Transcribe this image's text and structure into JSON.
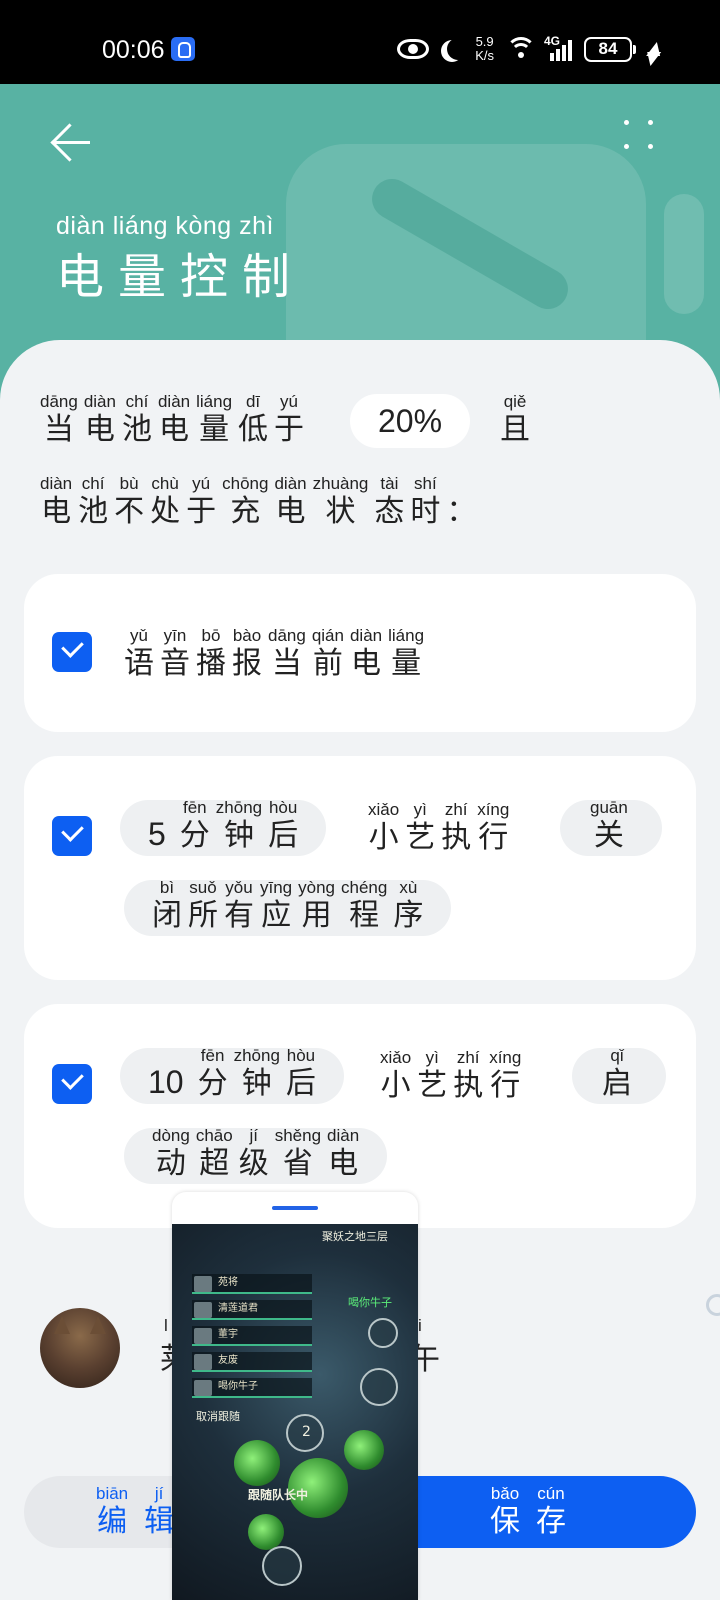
{
  "status_bar": {
    "time": "00:06",
    "net_speed_value": "5.9",
    "net_speed_unit": "K/s",
    "network_type": "4G",
    "battery_level": "84"
  },
  "header": {
    "title_pinyin": "diàn liáng kòng  zhì",
    "title": "电量控制"
  },
  "condition": {
    "line1": [
      {
        "py": "dāng",
        "hz": "当"
      },
      {
        "py": "diàn",
        "hz": "电"
      },
      {
        "py": "chí",
        "hz": "池"
      },
      {
        "py": "diàn",
        "hz": "电"
      },
      {
        "py": "liáng",
        "hz": "量"
      },
      {
        "py": "dī",
        "hz": "低"
      },
      {
        "py": "yú",
        "hz": "于"
      }
    ],
    "threshold": "20%",
    "and_py": "qiě",
    "and_hz": "且",
    "line2": [
      {
        "py": "diàn",
        "hz": "电"
      },
      {
        "py": "chí",
        "hz": "池"
      },
      {
        "py": "bù",
        "hz": "不"
      },
      {
        "py": "chù",
        "hz": "处"
      },
      {
        "py": "yú",
        "hz": "于"
      },
      {
        "py": "chōng",
        "hz": "充"
      },
      {
        "py": "diàn",
        "hz": "电"
      },
      {
        "py": "zhuàng",
        "hz": "状"
      },
      {
        "py": "tài",
        "hz": "态"
      },
      {
        "py": "shí",
        "hz": "时"
      },
      {
        "py": "",
        "hz": "："
      }
    ]
  },
  "actions": [
    {
      "checked": true,
      "text": [
        {
          "py": "yǔ",
          "hz": "语"
        },
        {
          "py": "yīn",
          "hz": "音"
        },
        {
          "py": "bō",
          "hz": "播"
        },
        {
          "py": "bào",
          "hz": "报"
        },
        {
          "py": "dāng",
          "hz": "当"
        },
        {
          "py": "qián",
          "hz": "前"
        },
        {
          "py": "diàn",
          "hz": "电"
        },
        {
          "py": "liáng",
          "hz": "量"
        }
      ]
    },
    {
      "checked": true,
      "delay_num": "5",
      "delay_text": [
        {
          "py": "fēn",
          "hz": "分"
        },
        {
          "py": "zhōng",
          "hz": "钟"
        },
        {
          "py": "hòu",
          "hz": "后"
        }
      ],
      "middle": [
        {
          "py": "xiǎo",
          "hz": "小"
        },
        {
          "py": "yì",
          "hz": "艺"
        },
        {
          "py": "zhí",
          "hz": "执"
        },
        {
          "py": "xíng",
          "hz": "行"
        }
      ],
      "task": [
        {
          "py": "guān",
          "hz": "关"
        }
      ],
      "task_cont": [
        {
          "py": "bì",
          "hz": "闭"
        },
        {
          "py": "suǒ",
          "hz": "所"
        },
        {
          "py": "yǒu",
          "hz": "有"
        },
        {
          "py": "yīng",
          "hz": "应"
        },
        {
          "py": "yòng",
          "hz": "用"
        },
        {
          "py": "chéng",
          "hz": "程"
        },
        {
          "py": "xù",
          "hz": "序"
        }
      ]
    },
    {
      "checked": true,
      "delay_num": "10",
      "delay_text": [
        {
          "py": "fēn",
          "hz": "分"
        },
        {
          "py": "zhōng",
          "hz": "钟"
        },
        {
          "py": "hòu",
          "hz": "后"
        }
      ],
      "middle": [
        {
          "py": "xiǎo",
          "hz": "小"
        },
        {
          "py": "yì",
          "hz": "艺"
        },
        {
          "py": "zhí",
          "hz": "执"
        },
        {
          "py": "xíng",
          "hz": "行"
        }
      ],
      "task": [
        {
          "py": "qǐ",
          "hz": "启"
        }
      ],
      "task_cont": [
        {
          "py": "dòng",
          "hz": "动"
        },
        {
          "py": "chāo",
          "hz": "超"
        },
        {
          "py": "jí",
          "hz": "级"
        },
        {
          "py": "shěng",
          "hz": "省"
        },
        {
          "py": "diàn",
          "hz": "电"
        }
      ]
    }
  ],
  "author": {
    "name_fragment_left": "莱",
    "name_fragment_left_py": "l",
    "name_fragment_right": "午",
    "name_fragment_right_py": "i"
  },
  "floating_window": {
    "texts": {
      "header": "聚妖之地三层",
      "top_tag": "喝你牛子",
      "roster": [
        "苑将",
        "清莲道君",
        "董宇",
        "友废",
        "喝你牛子"
      ],
      "cancel": "取消跟随",
      "follow": "跟随队长中",
      "cd": "2"
    }
  },
  "buttons": {
    "edit": [
      {
        "py": "biān",
        "hz": "编"
      },
      {
        "py": "jí",
        "hz": "辑"
      }
    ],
    "save": [
      {
        "py": "bǎo",
        "hz": "保"
      },
      {
        "py": "cún",
        "hz": "存"
      }
    ]
  },
  "colors": {
    "header_bg": "#58b2a3",
    "accent": "#0d5ff2",
    "page_bg": "#f1f3f5"
  }
}
